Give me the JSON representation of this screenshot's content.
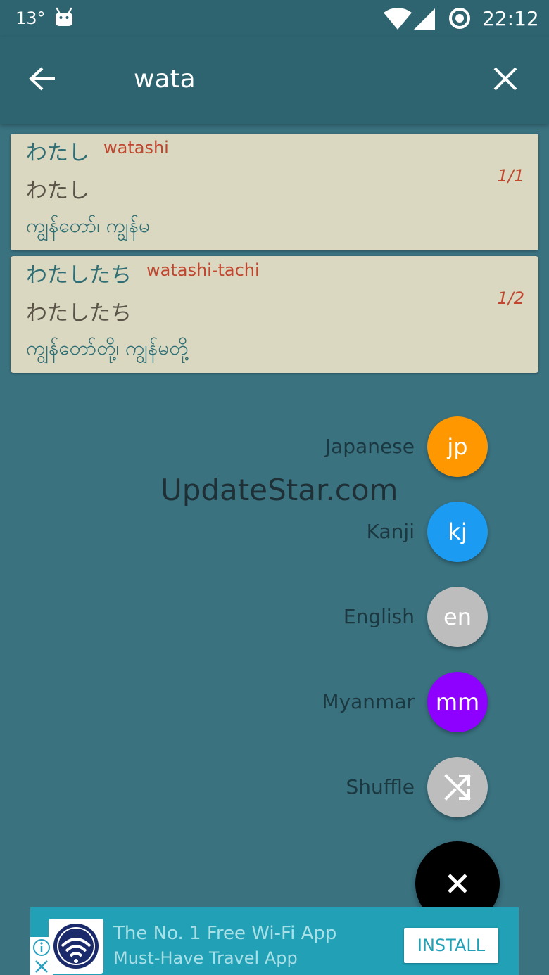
{
  "status_bar": {
    "temperature": "13°",
    "time": "22:12"
  },
  "app_bar": {
    "search_query": "wata"
  },
  "results": [
    {
      "kana": "わたし",
      "romaji": "watashi",
      "reading": "わたし",
      "myanmar": "ကျွန်တော်၊ ကျွန်မ",
      "count": "1/1"
    },
    {
      "kana": "わたしたち",
      "romaji": "watashi-tachi",
      "reading": "わたしたち",
      "myanmar": "ကျွန်တော်တို့၊ ကျွန်မတို့",
      "count": "1/2"
    }
  ],
  "watermark": "UpdateStar.com",
  "fab_menu": [
    {
      "label": "Japanese",
      "badge": "jp",
      "color": "#ff9800"
    },
    {
      "label": "Kanji",
      "badge": "kj",
      "color": "#1b9bf2"
    },
    {
      "label": "English",
      "badge": "en",
      "color": "#bdbdbd"
    },
    {
      "label": "Myanmar",
      "badge": "mm",
      "color": "#8e00ff"
    },
    {
      "label": "Shuffle",
      "badge": "",
      "icon": "shuffle-icon",
      "color": "#bdbdbd"
    }
  ],
  "ad": {
    "line1": "The No. 1 Free Wi-Fi App",
    "line2": "Must-Have Travel App",
    "install_label": "INSTALL"
  }
}
